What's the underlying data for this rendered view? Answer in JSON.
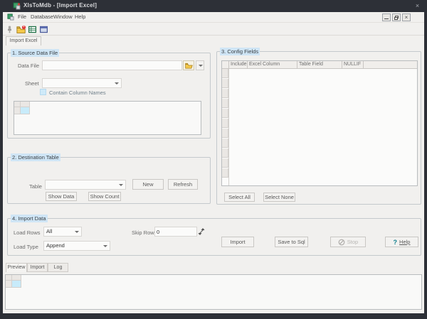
{
  "window": {
    "title": "XlsToMdb - [Import Excel]",
    "close_glyph": "×"
  },
  "menu": {
    "items": [
      "File",
      "Database",
      "Window",
      "Help"
    ]
  },
  "toolbar": {
    "icon_names": [
      "connect-icon",
      "open-database-icon",
      "import-excel-icon",
      "window-icon"
    ]
  },
  "main_tab": {
    "label": "Import Excel"
  },
  "source_group": {
    "title": "1. Source Data File",
    "data_file_label": "Data File",
    "data_file_value": "",
    "sheet_label": "Sheet",
    "sheet_value": "",
    "contain_column_names_label": "Contain Column Names",
    "contain_column_names_checked": false
  },
  "destination_group": {
    "title": "2. Destination Table",
    "table_label": "Table",
    "table_value": "",
    "new_button": "New",
    "refresh_button": "Refresh",
    "show_data_button": "Show Data",
    "show_count_button": "Show Count"
  },
  "config_group": {
    "title": "3. Config Fields",
    "columns": [
      "Include",
      "Excel Column",
      "Table Field",
      "NULLIF",
      ""
    ],
    "select_all_button": "Select All",
    "select_none_button": "Select None"
  },
  "import_group": {
    "title": "4. Import Data",
    "load_rows_label": "Load Rows",
    "load_rows_value": "All",
    "skip_rows_label": "Skip Rows",
    "skip_rows_value": "0",
    "load_type_label": "Load Type",
    "load_type_value": "Append",
    "import_button": "Import",
    "save_to_sql_button": "Save to Sql",
    "stop_button": "Stop",
    "help_button": "Help",
    "help_icon_glyph": "?"
  },
  "bottom_tabs": {
    "tabs": [
      "Preview",
      "Import",
      "Log"
    ],
    "active": "Preview"
  },
  "colors": {
    "frame": "#2d3037",
    "client_bg": "#f1f0ee",
    "group_title_bg": "#cfe5f5",
    "selected_cell": "#c8ebfa",
    "help_icon": "#0e7f8d",
    "disabled_text": "#b8b6b3"
  }
}
